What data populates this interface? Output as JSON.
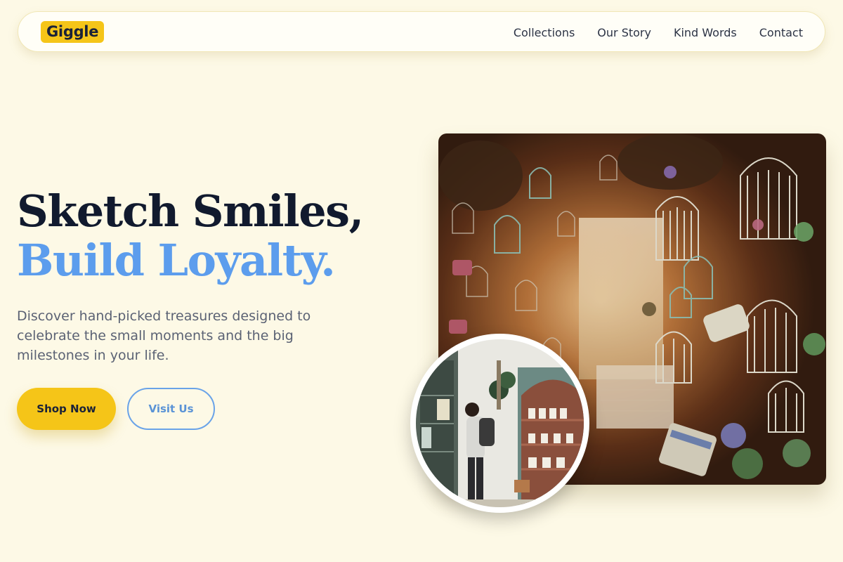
{
  "header": {
    "logo": "Giggle",
    "nav": [
      "Collections",
      "Our Story",
      "Kind Words",
      "Contact"
    ]
  },
  "hero": {
    "title_line1": "Sketch Smiles,",
    "title_line2": "Build Loyalty.",
    "description": "Discover hand-picked treasures designed to celebrate the small moments and the big milestones in your life.",
    "primary_cta": "Shop Now",
    "secondary_cta": "Visit Us"
  },
  "colors": {
    "background": "#fdf9e6",
    "accent_yellow": "#f5c518",
    "accent_blue": "#5c9ded",
    "navy": "#111a2e"
  },
  "images": {
    "main": "hanging-birdcages-shop-photo",
    "inset": "shopper-browsing-store-photo"
  }
}
